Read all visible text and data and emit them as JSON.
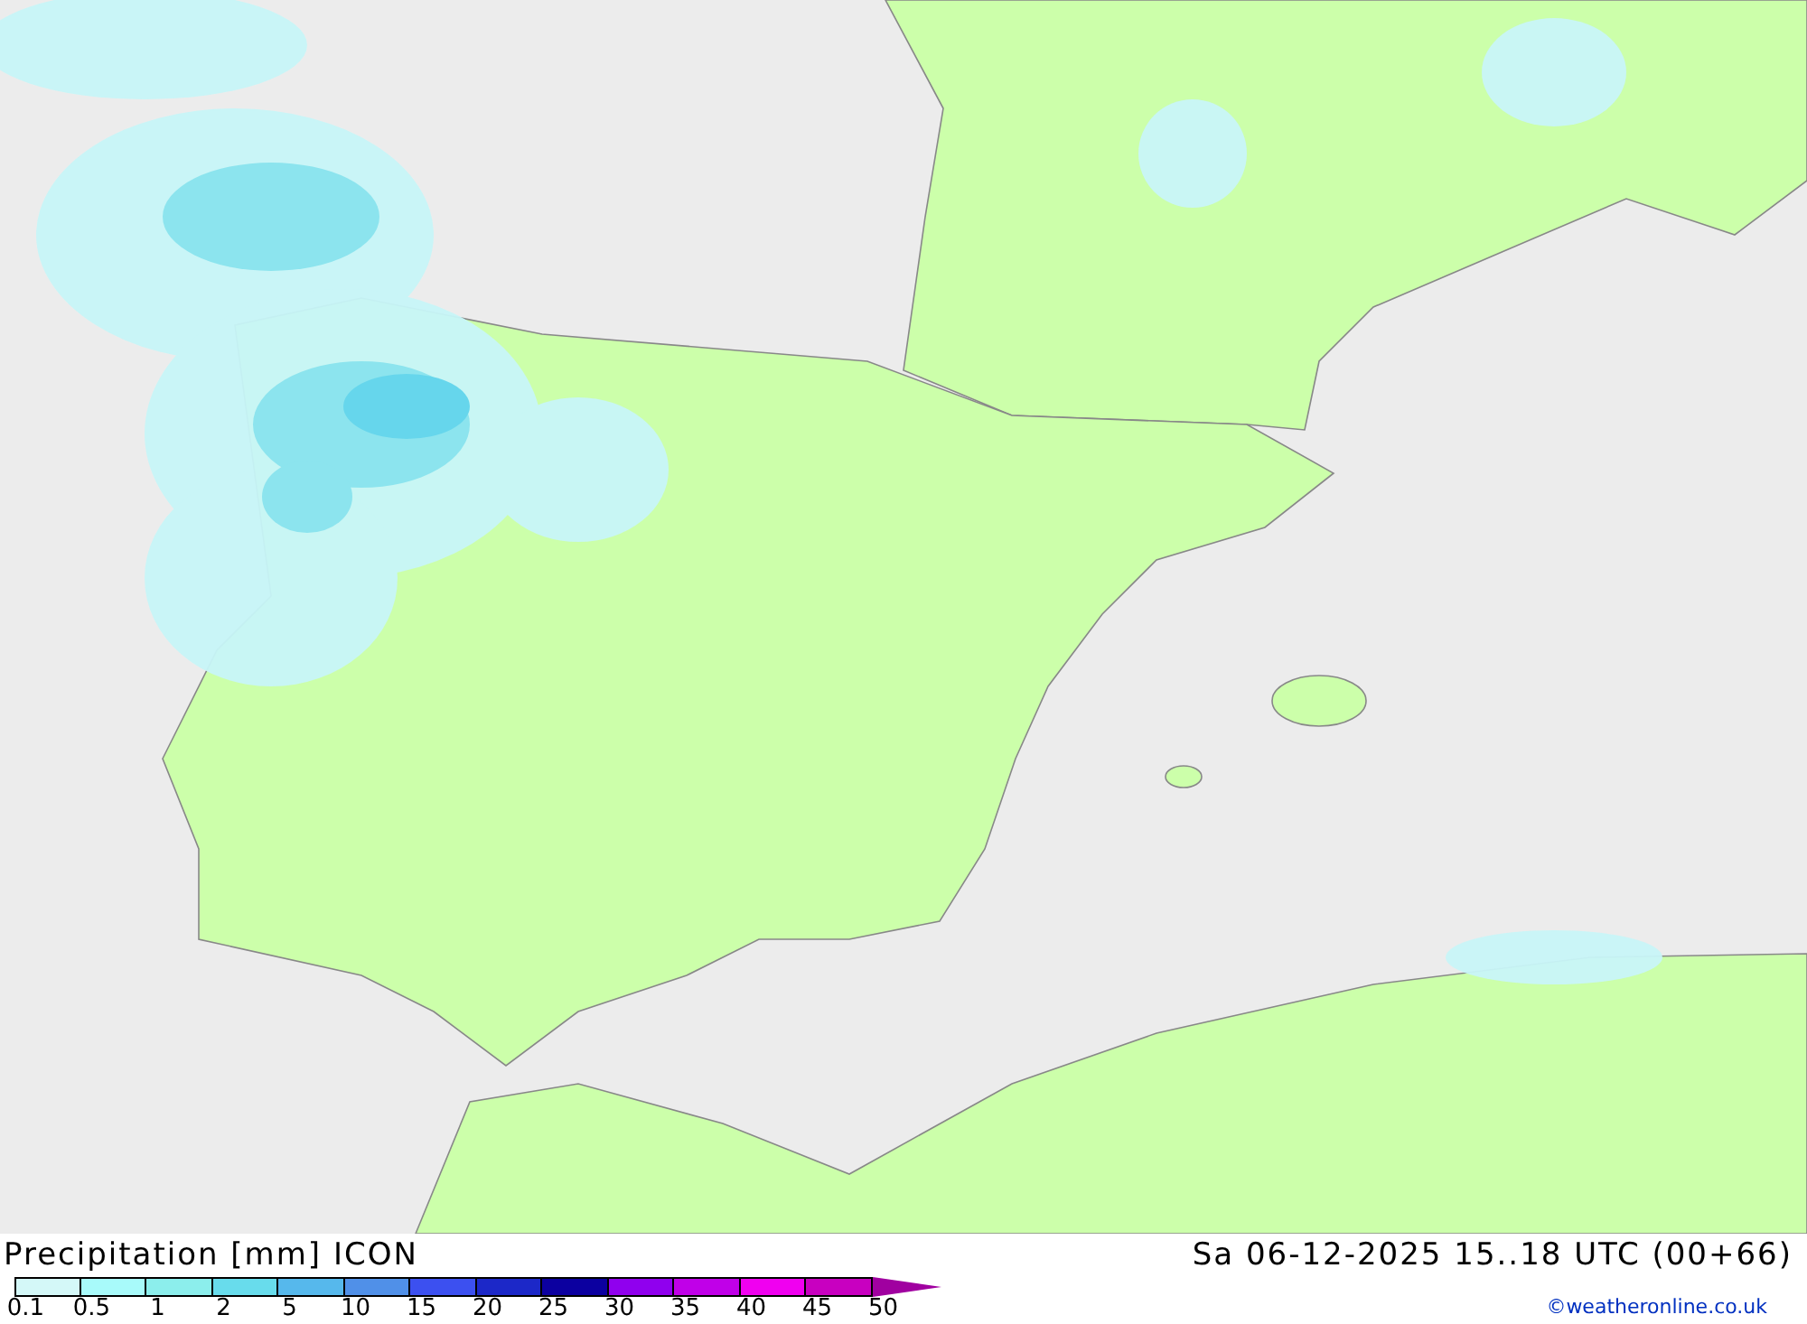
{
  "title": "Precipitation [mm] ICON",
  "valid_time": "Sa 06-12-2025 15..18 UTC (00+66)",
  "legend": {
    "items": [
      {
        "label": "0.1",
        "color": "#d4f8f8"
      },
      {
        "label": "0.5",
        "color": "#a8fafa"
      },
      {
        "label": "1",
        "color": "#8ceeec"
      },
      {
        "label": "2",
        "color": "#68dcec"
      },
      {
        "label": "5",
        "color": "#56b8ec"
      },
      {
        "label": "10",
        "color": "#5090e8"
      },
      {
        "label": "15",
        "color": "#3c50f0"
      },
      {
        "label": "20",
        "color": "#1c28c8"
      },
      {
        "label": "25",
        "color": "#0c00a0"
      },
      {
        "label": "30",
        "color": "#9000ee"
      },
      {
        "label": "35",
        "color": "#c000e8"
      },
      {
        "label": "40",
        "color": "#f000f0"
      },
      {
        "label": "45",
        "color": "#c800c0"
      },
      {
        "label": "50",
        "color": "#a000a0"
      }
    ]
  },
  "credit": "©weatheronline.co.uk"
}
